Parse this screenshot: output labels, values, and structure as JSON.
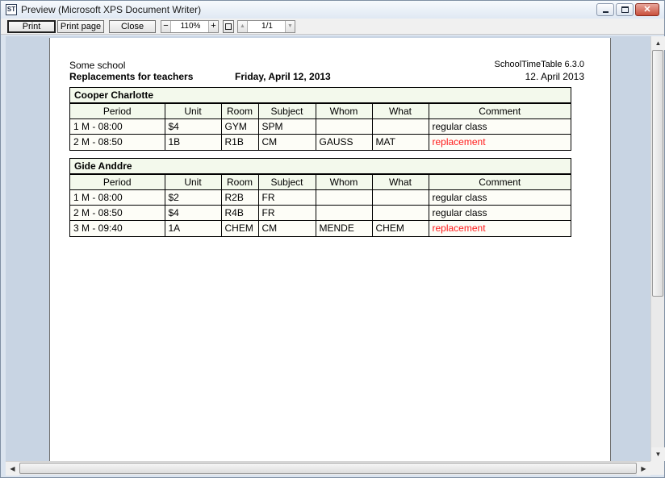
{
  "window": {
    "title": "Preview (Microsoft XPS Document Writer)",
    "icon": "ST"
  },
  "toolbar": {
    "print_label": "Print",
    "print_page_label": "Print page",
    "close_label": "Close",
    "zoom_minus": "−",
    "zoom_value": "110%",
    "zoom_plus": "+",
    "page_up": "▲",
    "page_value": "1/1",
    "page_down": "▼"
  },
  "report": {
    "school": "Some school",
    "title": "Replacements for teachers",
    "date": "Friday, April 12, 2013",
    "app_version": "SchoolTimeTable 6.3.0",
    "print_date": "12. April 2013",
    "columns": [
      "Period",
      "Unit",
      "Room",
      "Subject",
      "Whom",
      "What",
      "Comment"
    ],
    "teachers": [
      {
        "name": "Cooper Charlotte",
        "rows": [
          [
            "1 M - 08:00",
            "$4",
            "GYM",
            "SPM",
            "",
            "",
            "regular class"
          ],
          [
            "2 M - 08:50",
            "1B",
            "R1B",
            "CM",
            "GAUSS",
            "MAT",
            "replacement"
          ]
        ]
      },
      {
        "name": "Gide Anddre",
        "rows": [
          [
            "1 M - 08:00",
            "$2",
            "R2B",
            "FR",
            "",
            "",
            "regular class"
          ],
          [
            "2 M - 08:50",
            "$4",
            "R4B",
            "FR",
            "",
            "",
            "regular class"
          ],
          [
            "3 M - 09:40",
            "1A",
            "CHEM",
            "CM",
            "MENDE",
            "CHEM",
            "replacement"
          ]
        ]
      }
    ]
  },
  "colors": {
    "replacement_text": "#ff1a1a",
    "header_fill": "#f3f9ec"
  }
}
